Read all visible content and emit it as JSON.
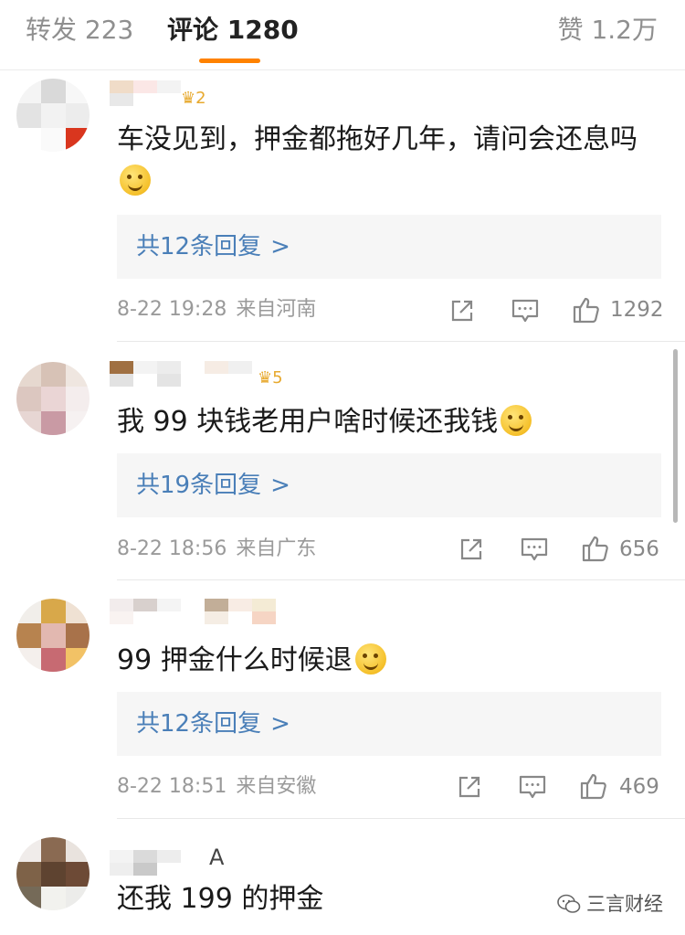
{
  "tabs": {
    "repost": "转发 223",
    "comment": "评论 1280",
    "like": "赞 1.2万"
  },
  "comments": [
    {
      "badge": "2",
      "text": "车没见到，押金都拖好几年，请问会还息吗",
      "reply_label": "共12条回复",
      "reply_chevron": ">",
      "time": "8-22 19:28",
      "location": "来自河南",
      "likes": "1292"
    },
    {
      "badge": "5",
      "text": "我 99 块钱老用户啥时候还我钱",
      "reply_label": "共19条回复",
      "reply_chevron": ">",
      "time": "8-22 18:56",
      "location": "来自广东",
      "likes": "656"
    },
    {
      "text": "99 押金什么时候退",
      "reply_label": "共12条回复",
      "reply_chevron": ">",
      "time": "8-22 18:51",
      "location": "来自安徽",
      "likes": "469"
    },
    {
      "name_fragment": "A",
      "text": "还我 199 的押金"
    }
  ],
  "icons": {
    "share": "share-icon",
    "comment": "comment-icon",
    "like": "thumbs-up-icon",
    "emoji": "emoji-icon",
    "watermark": "wechat-icon"
  },
  "colors": {
    "accent": "#ff8200",
    "link": "#4a7fb8",
    "muted": "#9a9a9a"
  },
  "watermark": "三言财经"
}
